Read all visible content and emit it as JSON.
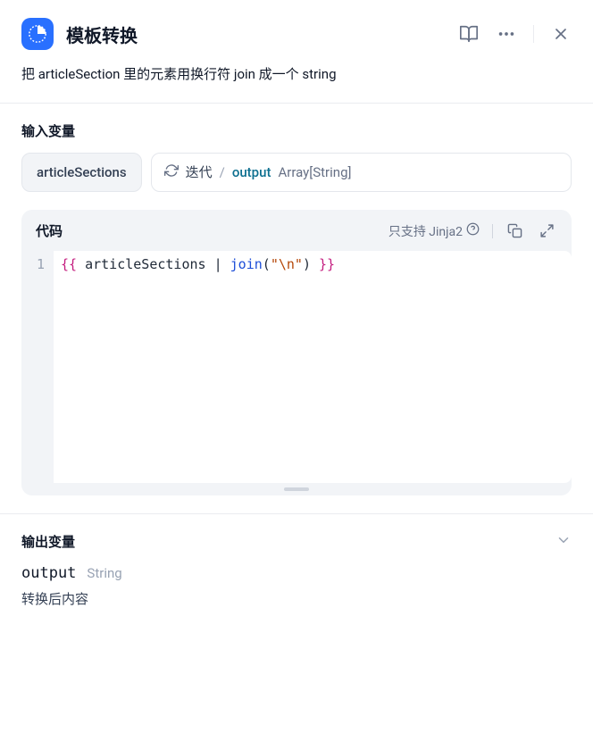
{
  "header": {
    "title": "模板转换"
  },
  "description": "把 articleSection 里的元素用换行符 join 成一个 string",
  "inputVars": {
    "sectionTitle": "输入变量",
    "varName": "articleSections",
    "iterateLabel": "迭代",
    "sourceName": "output",
    "sourceType": "Array[String]"
  },
  "code": {
    "title": "代码",
    "hint": "只支持 Jinja2",
    "lineNumber": "1",
    "tokens": {
      "open": "{{",
      "name": "articleSections",
      "pipe": "|",
      "func": "join",
      "lparen": "(",
      "str": "\"\\n\"",
      "rparen": ")",
      "close": "}}"
    }
  },
  "outputVars": {
    "sectionTitle": "输出变量",
    "name": "output",
    "type": "String",
    "desc": "转换后内容"
  }
}
